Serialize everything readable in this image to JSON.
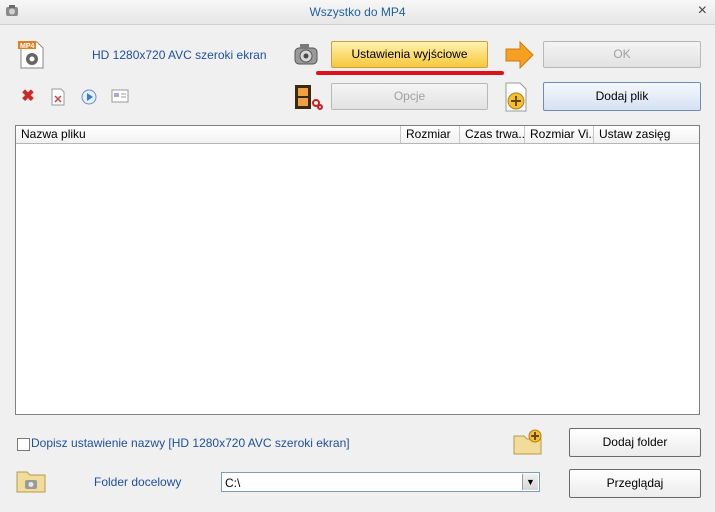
{
  "window": {
    "title": "Wszystko do MP4",
    "close_glyph": "×"
  },
  "profile": {
    "name": "HD 1280x720 AVC szeroki ekran",
    "badge": "MP4"
  },
  "buttons": {
    "output_settings": "Ustawienia wyjściowe",
    "ok": "OK",
    "options": "Opcje",
    "add_file": "Dodaj plik",
    "add_folder": "Dodaj folder",
    "browse": "Przeglądaj"
  },
  "toolbar": {
    "icons": [
      "delete-icon",
      "clear-icon",
      "play-icon",
      "info-icon"
    ]
  },
  "file_list": {
    "columns": [
      "Nazwa pliku",
      "Rozmiar",
      "Czas trwa...",
      "Rozmiar Vi...",
      "Ustaw zasięg"
    ]
  },
  "append_name": {
    "label": "Dopisz ustawienie nazwy [HD 1280x720 AVC szeroki ekran]",
    "checked": false
  },
  "destination": {
    "label": "Folder docelowy",
    "value": "C:\\"
  },
  "colors": {
    "accent_text": "#1f4f9f",
    "highlight_underline": "#e0101a",
    "primary_button": "#f7c83a"
  }
}
